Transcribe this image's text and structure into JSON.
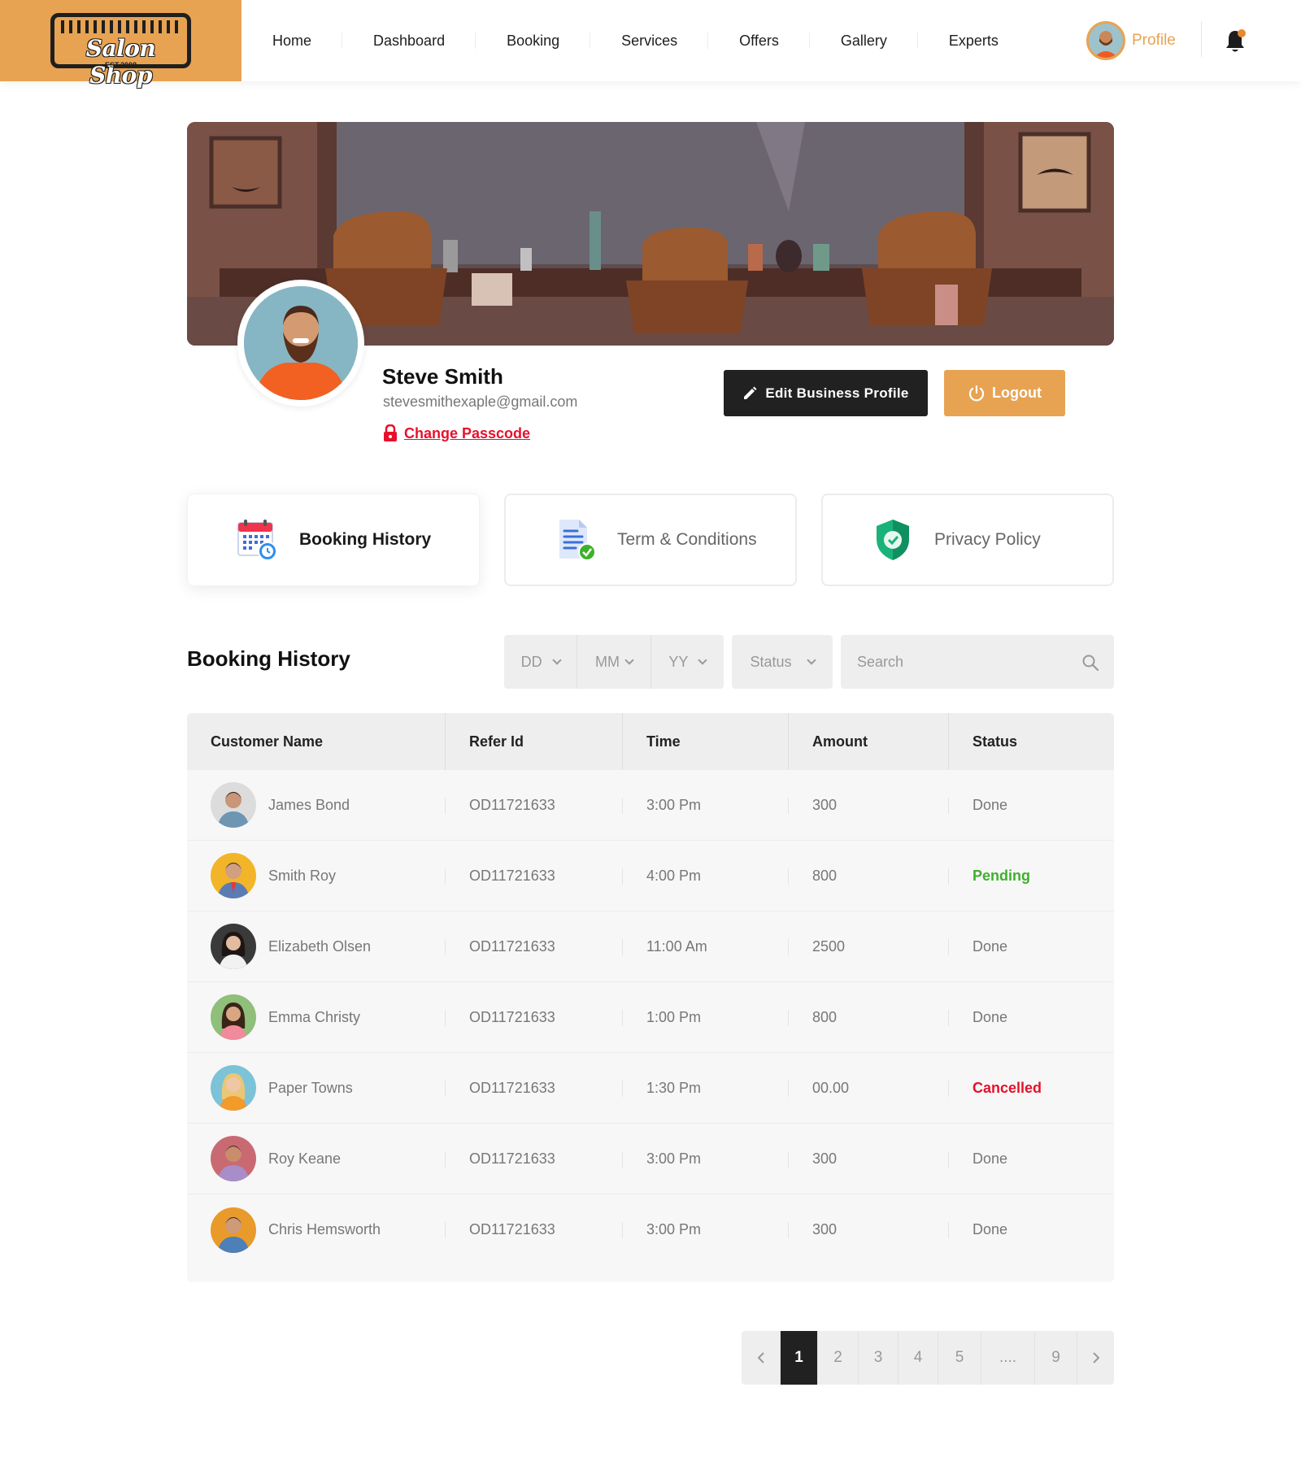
{
  "brand": {
    "name": "Salon Shop",
    "est": "EST.2008"
  },
  "nav": [
    "Home",
    "Dashboard",
    "Booking",
    "Services",
    "Offers",
    "Gallery",
    "Experts"
  ],
  "header": {
    "profile_label": "Profile"
  },
  "profile": {
    "name": "Steve Smith",
    "email": "stevesmithexaple@gmail.com",
    "change_passcode": "Change Passcode",
    "edit_button": "Edit Business Profile",
    "logout_button": "Logout"
  },
  "cards": [
    {
      "label": "Booking  History",
      "icon": "calendar-clock-icon",
      "active": true
    },
    {
      "label": "Term & Conditions",
      "icon": "document-check-icon",
      "active": false
    },
    {
      "label": "Privacy Policy",
      "icon": "shield-check-icon",
      "active": false
    }
  ],
  "booking": {
    "title": "Booking History",
    "filters": {
      "day": "DD",
      "month": "MM",
      "year": "YY",
      "status": "Status"
    },
    "search_placeholder": "Search",
    "columns": [
      "Customer Name",
      "Refer Id",
      "Time",
      "Amount",
      "Status"
    ],
    "rows": [
      {
        "name": "James Bond",
        "refer_id": "OD11721633",
        "time": "3:00 Pm",
        "amount": "300",
        "status": "Done"
      },
      {
        "name": "Smith Roy",
        "refer_id": "OD11721633",
        "time": "4:00 Pm",
        "amount": "800",
        "status": "Pending"
      },
      {
        "name": "Elizabeth Olsen",
        "refer_id": "OD11721633",
        "time": "11:00 Am",
        "amount": "2500",
        "status": "Done"
      },
      {
        "name": "Emma Christy",
        "refer_id": "OD11721633",
        "time": "1:00 Pm",
        "amount": "800",
        "status": "Done"
      },
      {
        "name": "Paper Towns",
        "refer_id": "OD11721633",
        "time": "1:30 Pm",
        "amount": "00.00",
        "status": "Cancelled"
      },
      {
        "name": "Roy Keane",
        "refer_id": "OD11721633",
        "time": "3:00 Pm",
        "amount": "300",
        "status": "Done"
      },
      {
        "name": "Chris Hemsworth",
        "refer_id": "OD11721633",
        "time": "3:00 Pm",
        "amount": "300",
        "status": "Done"
      }
    ]
  },
  "pagination": {
    "pages": [
      "1",
      "2",
      "3",
      "4",
      "5",
      "....",
      "9"
    ],
    "current": "1"
  },
  "colors": {
    "accent": "#e8a352",
    "dark": "#212121",
    "danger": "#e7112c",
    "success": "#3fb02c",
    "muted": "#777777"
  }
}
